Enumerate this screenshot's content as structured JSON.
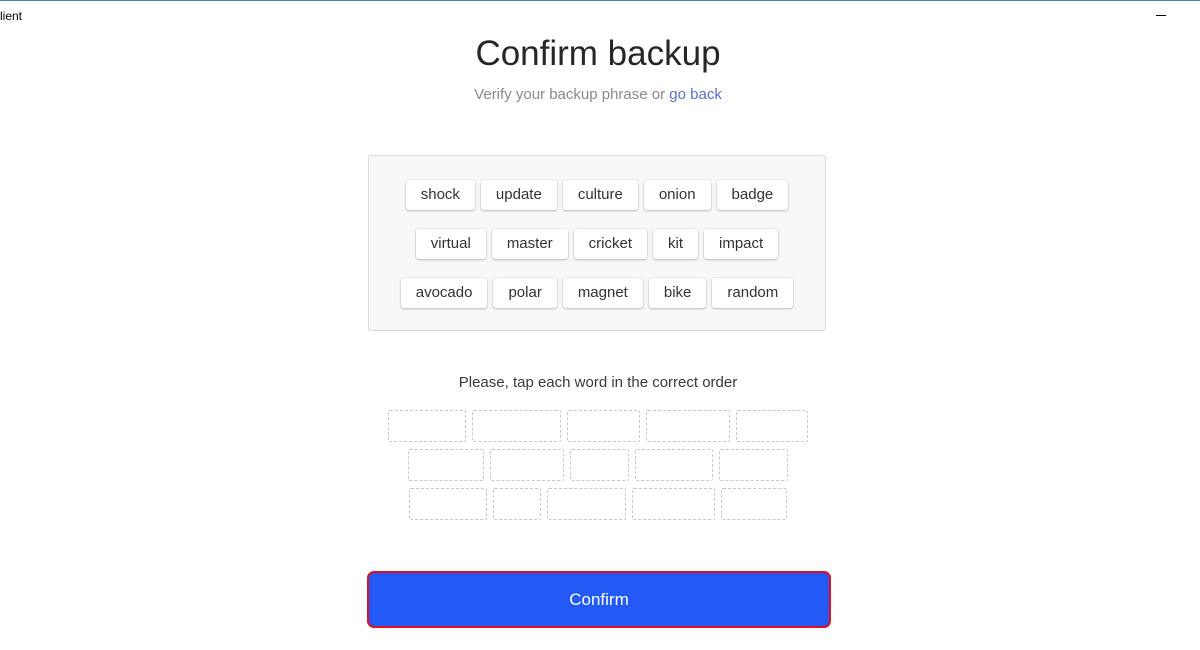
{
  "window": {
    "title": "lient"
  },
  "header": {
    "title": "Confirm backup",
    "subtitle_text": "Verify your backup phrase or ",
    "go_back_label": "go back"
  },
  "word_bank": {
    "rows": [
      [
        "shock",
        "update",
        "culture",
        "onion",
        "badge"
      ],
      [
        "virtual",
        "master",
        "cricket",
        "kit",
        "impact"
      ],
      [
        "avocado",
        "polar",
        "magnet",
        "bike",
        "random"
      ]
    ]
  },
  "instruction": "Please, tap each word in the correct order",
  "answer_slots": {
    "rows": [
      5,
      5,
      5
    ],
    "filled": []
  },
  "confirm_button": {
    "label": "Confirm"
  },
  "colors": {
    "accent": "#2359f5",
    "focus_outline": "#e01020",
    "link": "#5a6fd6"
  }
}
